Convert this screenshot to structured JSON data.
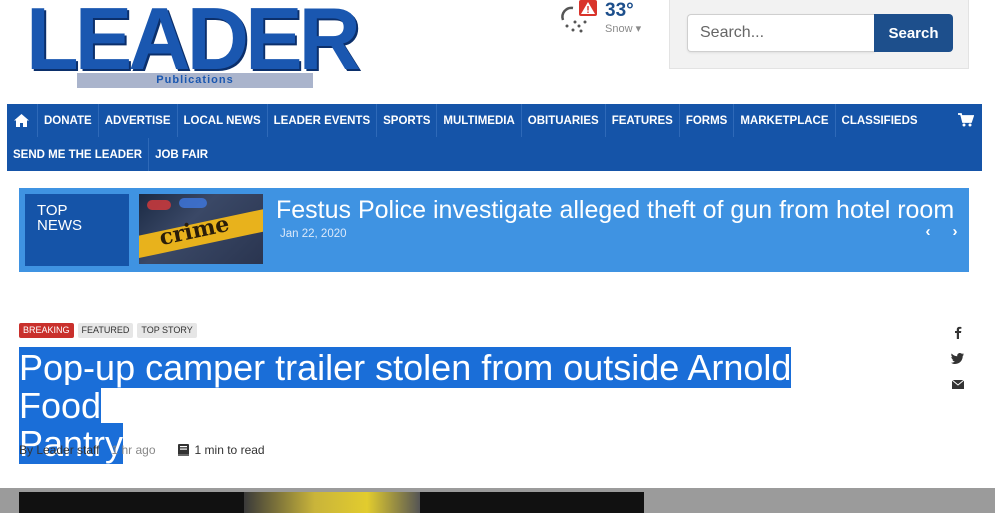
{
  "logo": {
    "word": "LEADER",
    "sub": "Publications"
  },
  "weather": {
    "temp": "33°",
    "condition": "Snow"
  },
  "search": {
    "placeholder": "Search...",
    "button": "Search"
  },
  "nav": {
    "row1": [
      "DONATE",
      "ADVERTISE",
      "LOCAL NEWS",
      "LEADER EVENTS",
      "SPORTS",
      "MULTIMEDIA",
      "OBITUARIES",
      "FEATURES",
      "FORMS",
      "MARKETPLACE",
      "CLASSIFIEDS"
    ],
    "row2": [
      "SEND ME THE LEADER",
      "JOB FAIR"
    ]
  },
  "ticker": {
    "label_line1": "TOP",
    "label_line2": "NEWS",
    "thumb_word": "crime",
    "title": "Festus Police investigate alleged theft of gun from hotel room",
    "date": "Jan 22, 2020"
  },
  "article": {
    "tags": [
      "BREAKING",
      "FEATURED",
      "TOP STORY"
    ],
    "headline_line1": "Pop-up camper trailer stolen from outside Arnold Food",
    "headline_line2": "Pantry",
    "author": "By Leader staff",
    "time": "1 hr ago",
    "read_time": "1 min to read"
  },
  "colors": {
    "brand_blue": "#1554a8",
    "ticker_blue": "#3f93e2",
    "selection": "#1a6ed8",
    "breaking_red": "#c9302c",
    "search_button": "#1d4f8c"
  }
}
